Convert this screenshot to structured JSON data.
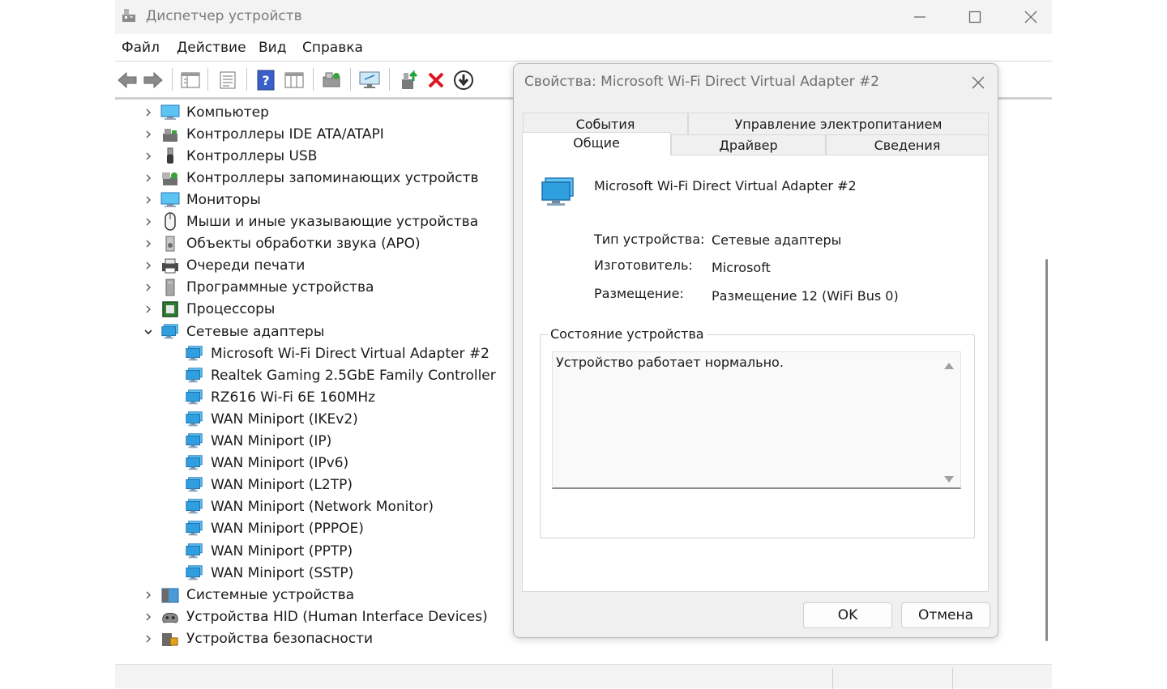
{
  "window": {
    "title": "Диспетчер устройств"
  },
  "menu": [
    "Файл",
    "Действие",
    "Вид",
    "Справка"
  ],
  "toolbar_icons": [
    "back-arrow-icon",
    "forward-arrow-icon",
    "properties-grid-icon",
    "list-view-icon",
    "help-icon",
    "details-view-icon",
    "scan-hardware-icon",
    "monitor-icon",
    "update-driver-icon",
    "uninstall-icon",
    "disable-device-icon"
  ],
  "tree": {
    "categories_top": [
      {
        "label": "Компьютер",
        "icon": "computer-icon"
      },
      {
        "label": "Контроллеры IDE ATA/ATAPI",
        "icon": "ide-controller-icon"
      },
      {
        "label": "Контроллеры USB",
        "icon": "usb-icon"
      },
      {
        "label": "Контроллеры запоминающих устройств",
        "icon": "storage-controller-icon"
      },
      {
        "label": "Мониторы",
        "icon": "monitor-icon"
      },
      {
        "label": "Мыши и иные указывающие устройства",
        "icon": "mouse-icon"
      },
      {
        "label": "Объекты обработки звука (APO)",
        "icon": "speaker-icon"
      },
      {
        "label": "Очереди печати",
        "icon": "printer-icon"
      },
      {
        "label": "Программные устройства",
        "icon": "software-device-icon"
      },
      {
        "label": "Процессоры",
        "icon": "processor-icon"
      }
    ],
    "expanded_category": {
      "label": "Сетевые адаптеры",
      "icon": "network-adapter-icon"
    },
    "network_adapters": [
      "Microsoft Wi-Fi Direct Virtual Adapter #2",
      "Realtek Gaming 2.5GbE Family Controller",
      "RZ616 Wi-Fi 6E 160MHz",
      "WAN Miniport (IKEv2)",
      "WAN Miniport (IP)",
      "WAN Miniport (IPv6)",
      "WAN Miniport (L2TP)",
      "WAN Miniport (Network Monitor)",
      "WAN Miniport (PPPOE)",
      "WAN Miniport (PPTP)",
      "WAN Miniport (SSTP)"
    ],
    "categories_bottom": [
      {
        "label": "Системные устройства",
        "icon": "system-devices-icon"
      },
      {
        "label": "Устройства HID (Human Interface Devices)",
        "icon": "hid-icon"
      },
      {
        "label": "Устройства безопасности",
        "icon": "security-device-icon"
      }
    ]
  },
  "dialog": {
    "title": "Свойства: Microsoft Wi-Fi Direct Virtual Adapter #2",
    "tabs_back": [
      "События",
      "Управление электропитанием"
    ],
    "tabs_front": [
      "Общие",
      "Драйвер",
      "Сведения"
    ],
    "active_tab": "Общие",
    "device_name": "Microsoft Wi-Fi Direct Virtual Adapter #2",
    "props": [
      {
        "label": "Тип устройства:",
        "value": "Сетевые адаптеры"
      },
      {
        "label": "Изготовитель:",
        "value": "Microsoft"
      },
      {
        "label": "Размещение:",
        "value": "Размещение 12 (WiFi Bus 0)"
      }
    ],
    "status_group_label": "Состояние устройства",
    "status_text": "Устройство работает нормально.",
    "ok_label": "OK",
    "cancel_label": "Отмена"
  },
  "colors": {
    "network_icon_blue": "#2f9fe0",
    "uninstall_red": "#e0141e",
    "help_blue": "#3b5fc9"
  }
}
